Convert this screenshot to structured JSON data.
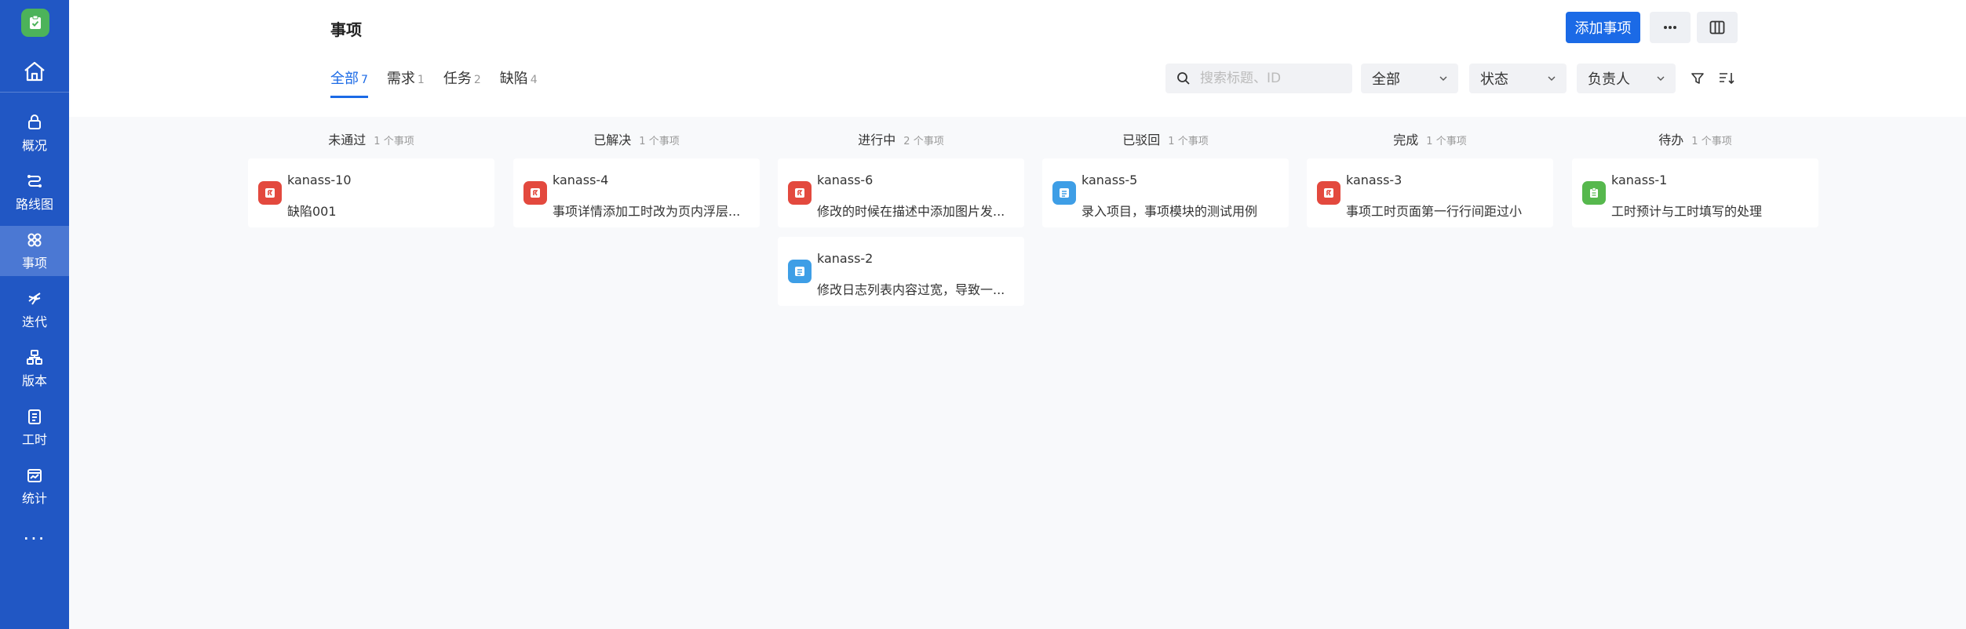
{
  "sidebar": {
    "items": [
      {
        "label": "概况",
        "icon": "overview-icon"
      },
      {
        "label": "路线图",
        "icon": "roadmap-icon"
      },
      {
        "label": "事项",
        "icon": "work-items-icon"
      },
      {
        "label": "迭代",
        "icon": "sprint-icon"
      },
      {
        "label": "版本",
        "icon": "version-icon"
      },
      {
        "label": "工时",
        "icon": "worklog-icon"
      },
      {
        "label": "统计",
        "icon": "statistics-icon"
      }
    ],
    "more": "···",
    "active": "事项"
  },
  "header": {
    "title": "事项",
    "add_button": "添加事项",
    "more_button": "···"
  },
  "tabs": [
    {
      "label": "全部",
      "count": "7"
    },
    {
      "label": "需求",
      "count": "1"
    },
    {
      "label": "任务",
      "count": "2"
    },
    {
      "label": "缺陷",
      "count": "4"
    }
  ],
  "filters": {
    "search_placeholder": "搜索标题、ID",
    "type_select": "全部",
    "status_select": "状态",
    "assignee_select": "负责人"
  },
  "columns": [
    {
      "title": "未通过",
      "count_text": "1 个事项",
      "cards": [
        {
          "key": "kanass-10",
          "name": "缺陷001",
          "type": "bug"
        }
      ]
    },
    {
      "title": "已解决",
      "count_text": "1 个事项",
      "cards": [
        {
          "key": "kanass-4",
          "name": "事项详情添加工时改为页内浮层...",
          "type": "bug"
        }
      ]
    },
    {
      "title": "进行中",
      "count_text": "2 个事项",
      "cards": [
        {
          "key": "kanass-6",
          "name": "修改的时候在描述中添加图片发...",
          "type": "bug"
        },
        {
          "key": "kanass-2",
          "name": "修改日志列表内容过宽，导致一...",
          "type": "requirement"
        }
      ]
    },
    {
      "title": "已驳回",
      "count_text": "1 个事项",
      "cards": [
        {
          "key": "kanass-5",
          "name": "录入项目，事项模块的测试用例",
          "type": "requirement"
        }
      ]
    },
    {
      "title": "完成",
      "count_text": "1 个事项",
      "cards": [
        {
          "key": "kanass-3",
          "name": "事项工时页面第一行行间距过小",
          "type": "bug"
        }
      ]
    },
    {
      "title": "待办",
      "count_text": "1 个事项",
      "cards": [
        {
          "key": "kanass-1",
          "name": "工时预计与工时填写的处理",
          "type": "task"
        }
      ]
    }
  ],
  "colors": {
    "sidebar": "#2157c4",
    "accent": "#1b6ae6",
    "bug": "#e3493e",
    "requirement": "#3e9ee6",
    "task": "#56b84d"
  }
}
